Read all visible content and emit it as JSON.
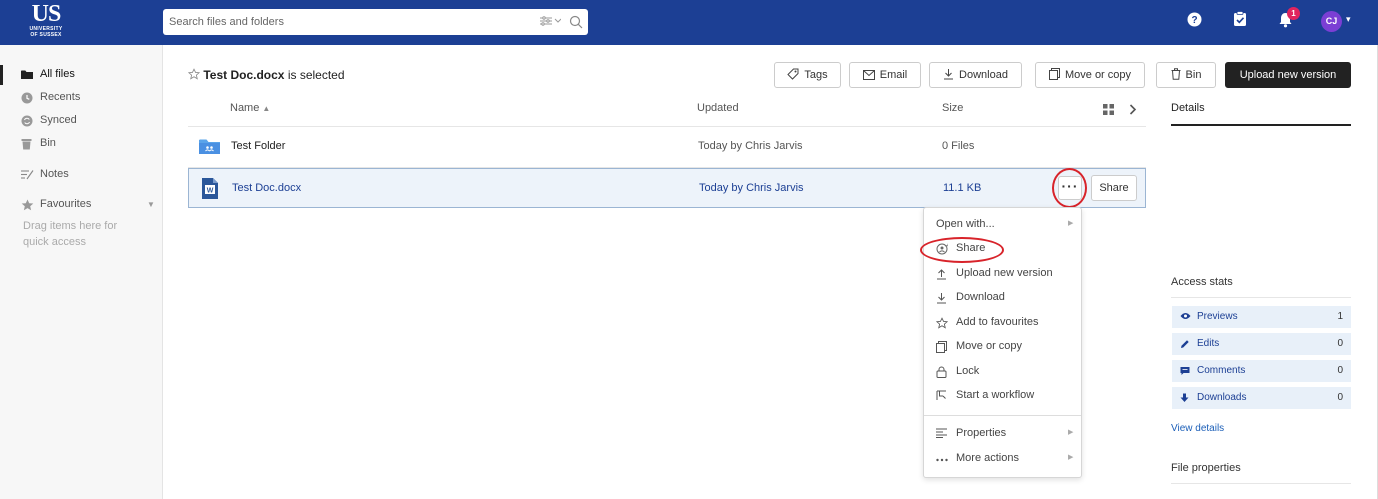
{
  "logo": {
    "main": "US",
    "line1": "UNIVERSITY",
    "line2": "OF SUSSEX"
  },
  "search": {
    "placeholder": "Search files and folders"
  },
  "header": {
    "notification_count": "1",
    "avatar_initials": "CJ"
  },
  "sidebar": {
    "items": [
      {
        "label": "All files",
        "icon": "folder-icon",
        "active": true
      },
      {
        "label": "Recents",
        "icon": "clock-icon"
      },
      {
        "label": "Synced",
        "icon": "sync-icon"
      },
      {
        "label": "Bin",
        "icon": "bin-icon"
      },
      {
        "label": "Notes",
        "icon": "notes-icon"
      },
      {
        "label": "Favourites",
        "icon": "star-icon"
      }
    ],
    "favourites_hint": "Drag items here for quick access"
  },
  "selection": {
    "filename": "Test Doc.docx",
    "suffix": "is selected"
  },
  "toolbar": {
    "tags": "Tags",
    "email": "Email",
    "download": "Download",
    "move_copy": "Move or copy",
    "bin": "Bin",
    "upload": "Upload new version"
  },
  "table": {
    "columns": {
      "name": "Name",
      "updated": "Updated",
      "size": "Size"
    },
    "rows": [
      {
        "name": "Test Folder",
        "updated": "Today by Chris Jarvis",
        "size": "0 Files",
        "icon": "shared-folder-icon"
      },
      {
        "name": "Test Doc.docx",
        "updated": "Today by Chris Jarvis",
        "size": "11.1 KB",
        "icon": "word-doc-icon",
        "selected": true
      }
    ],
    "share_label": "Share"
  },
  "context_menu": {
    "items": [
      {
        "label": "Open with...",
        "icon": "",
        "submenu": true
      },
      {
        "label": "Share",
        "icon": "share-icon"
      },
      {
        "label": "Upload new version",
        "icon": "upload-icon"
      },
      {
        "label": "Download",
        "icon": "download-icon"
      },
      {
        "label": "Add to favourites",
        "icon": "star-icon"
      },
      {
        "label": "Move or copy",
        "icon": "copy-icon"
      },
      {
        "label": "Lock",
        "icon": "lock-icon"
      },
      {
        "label": "Start a workflow",
        "icon": "workflow-icon"
      },
      {
        "label": "Properties",
        "icon": "properties-icon",
        "submenu": true
      },
      {
        "label": "More actions",
        "icon": "more-icon",
        "submenu": true
      }
    ]
  },
  "details": {
    "tab": "Details",
    "access_stats": "Access stats",
    "stats": [
      {
        "label": "Previews",
        "value": "1",
        "icon": "eye-icon"
      },
      {
        "label": "Edits",
        "value": "0",
        "icon": "pencil-icon"
      },
      {
        "label": "Comments",
        "value": "0",
        "icon": "comment-icon"
      },
      {
        "label": "Downloads",
        "value": "0",
        "icon": "download-arrow-icon"
      }
    ],
    "view_details": "View details",
    "file_properties": "File properties"
  },
  "colors": {
    "header": "#1c3f94",
    "highlight": "#d8232a",
    "selection": "#edf3fa",
    "accent": "#1c3f94"
  }
}
